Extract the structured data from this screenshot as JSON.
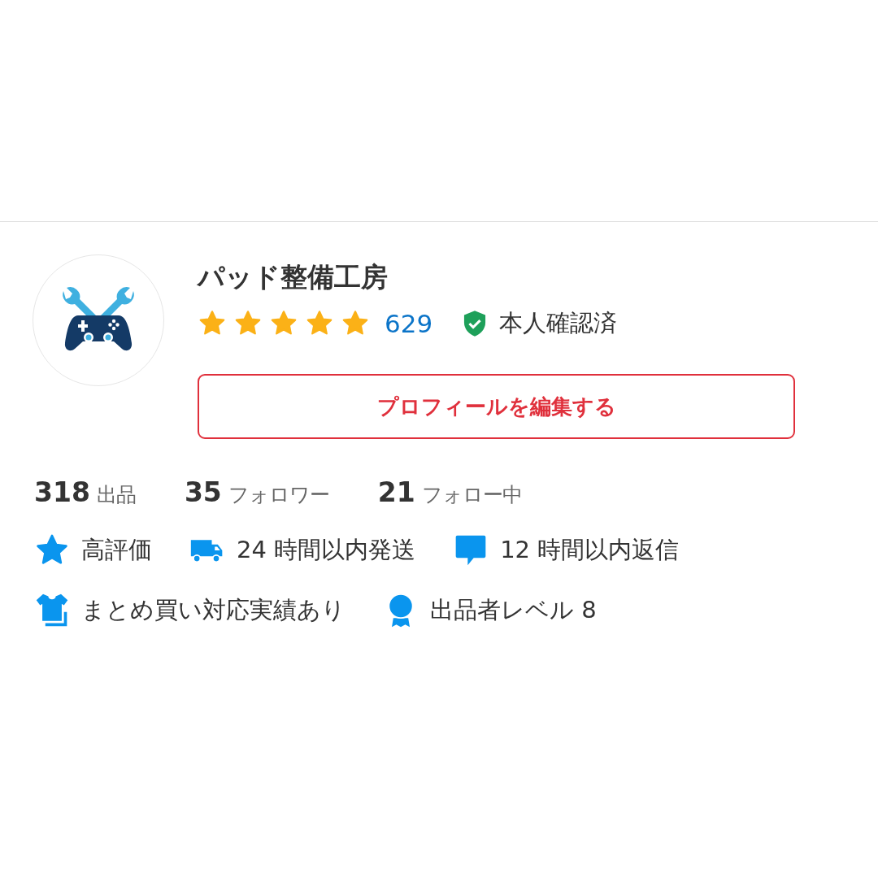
{
  "profile": {
    "name": "パッド整備工房",
    "rating": {
      "stars": 5,
      "count": "629"
    },
    "verified": {
      "label": "本人確認済"
    },
    "edit_button": "プロフィールを編集する"
  },
  "stats": [
    {
      "value": "318",
      "label": "出品"
    },
    {
      "value": "35",
      "label": "フォロワー"
    },
    {
      "value": "21",
      "label": "フォロー中"
    }
  ],
  "badge_rows": [
    [
      {
        "kind": "star",
        "label": "高評価"
      },
      {
        "kind": "truck",
        "label": "24 時間以内発送"
      },
      {
        "kind": "chat",
        "label": "12 時間以内返信"
      }
    ],
    [
      {
        "kind": "shirt",
        "label": "まとめ買い対応実績あり"
      },
      {
        "kind": "medal",
        "label": "出品者レベル 8"
      }
    ]
  ]
}
